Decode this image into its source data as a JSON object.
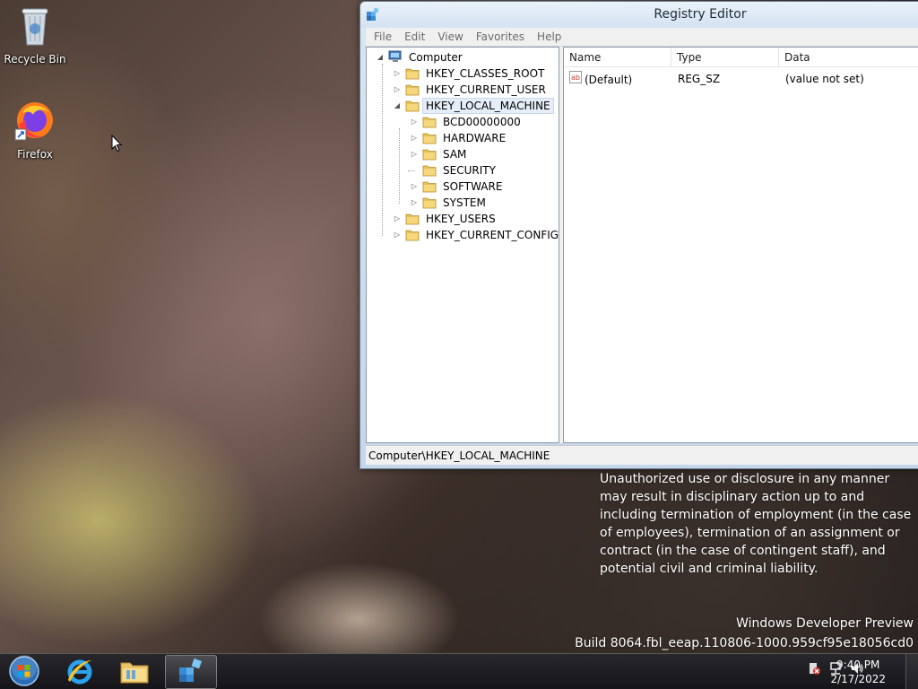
{
  "desktop": {
    "icons": [
      {
        "label": "Recycle Bin",
        "icon": "recycle-bin-icon"
      },
      {
        "label": "Firefox",
        "icon": "firefox-icon"
      }
    ]
  },
  "window": {
    "title": "Registry Editor",
    "menu": [
      "File",
      "Edit",
      "View",
      "Favorites",
      "Help"
    ],
    "tree": {
      "root": "Computer",
      "items": [
        {
          "label": "HKEY_CLASSES_ROOT",
          "level": 1,
          "expander": "collapsed"
        },
        {
          "label": "HKEY_CURRENT_USER",
          "level": 1,
          "expander": "collapsed"
        },
        {
          "label": "HKEY_LOCAL_MACHINE",
          "level": 1,
          "expander": "expanded",
          "selected": true
        },
        {
          "label": "BCD00000000",
          "level": 2,
          "expander": "collapsed"
        },
        {
          "label": "HARDWARE",
          "level": 2,
          "expander": "collapsed"
        },
        {
          "label": "SAM",
          "level": 2,
          "expander": "collapsed"
        },
        {
          "label": "SECURITY",
          "level": 2,
          "expander": "none"
        },
        {
          "label": "SOFTWARE",
          "level": 2,
          "expander": "collapsed"
        },
        {
          "label": "SYSTEM",
          "level": 2,
          "expander": "collapsed"
        },
        {
          "label": "HKEY_USERS",
          "level": 1,
          "expander": "collapsed"
        },
        {
          "label": "HKEY_CURRENT_CONFIG",
          "level": 1,
          "expander": "collapsed"
        }
      ]
    },
    "list": {
      "columns": [
        "Name",
        "Type",
        "Data"
      ],
      "rows": [
        {
          "name": "(Default)",
          "type": "REG_SZ",
          "data": "(value not set)",
          "icon": "string-value-icon"
        }
      ]
    },
    "status": "Computer\\HKEY_LOCAL_MACHINE"
  },
  "notice": "Unauthorized use or disclosure in any manner may result in disciplinary action up to and including termination of employment (in the case of employees), termination of an assignment or contract (in the case of contingent staff), and potential civil and criminal liability.",
  "watermark": {
    "line1": "Windows Developer Preview",
    "line2": "Build 8064.fbl_eeap.110806-1000.959cf95e18056cd0"
  },
  "taskbar": {
    "buttons": [
      {
        "name": "start",
        "icon": "windows-start-icon"
      },
      {
        "name": "internet-explorer",
        "icon": "ie-icon"
      },
      {
        "name": "file-explorer",
        "icon": "folder-icon"
      },
      {
        "name": "registry-editor",
        "icon": "regedit-icon",
        "active": true
      }
    ],
    "tray_icons": [
      "action-center-icon",
      "network-icon",
      "volume-icon"
    ],
    "clock": {
      "time": "9:40 PM",
      "date": "2/17/2022"
    }
  },
  "colors": {
    "selection": "#e5eef8",
    "folder": "#e8c15a",
    "menu_text": "#6b6b6b"
  }
}
